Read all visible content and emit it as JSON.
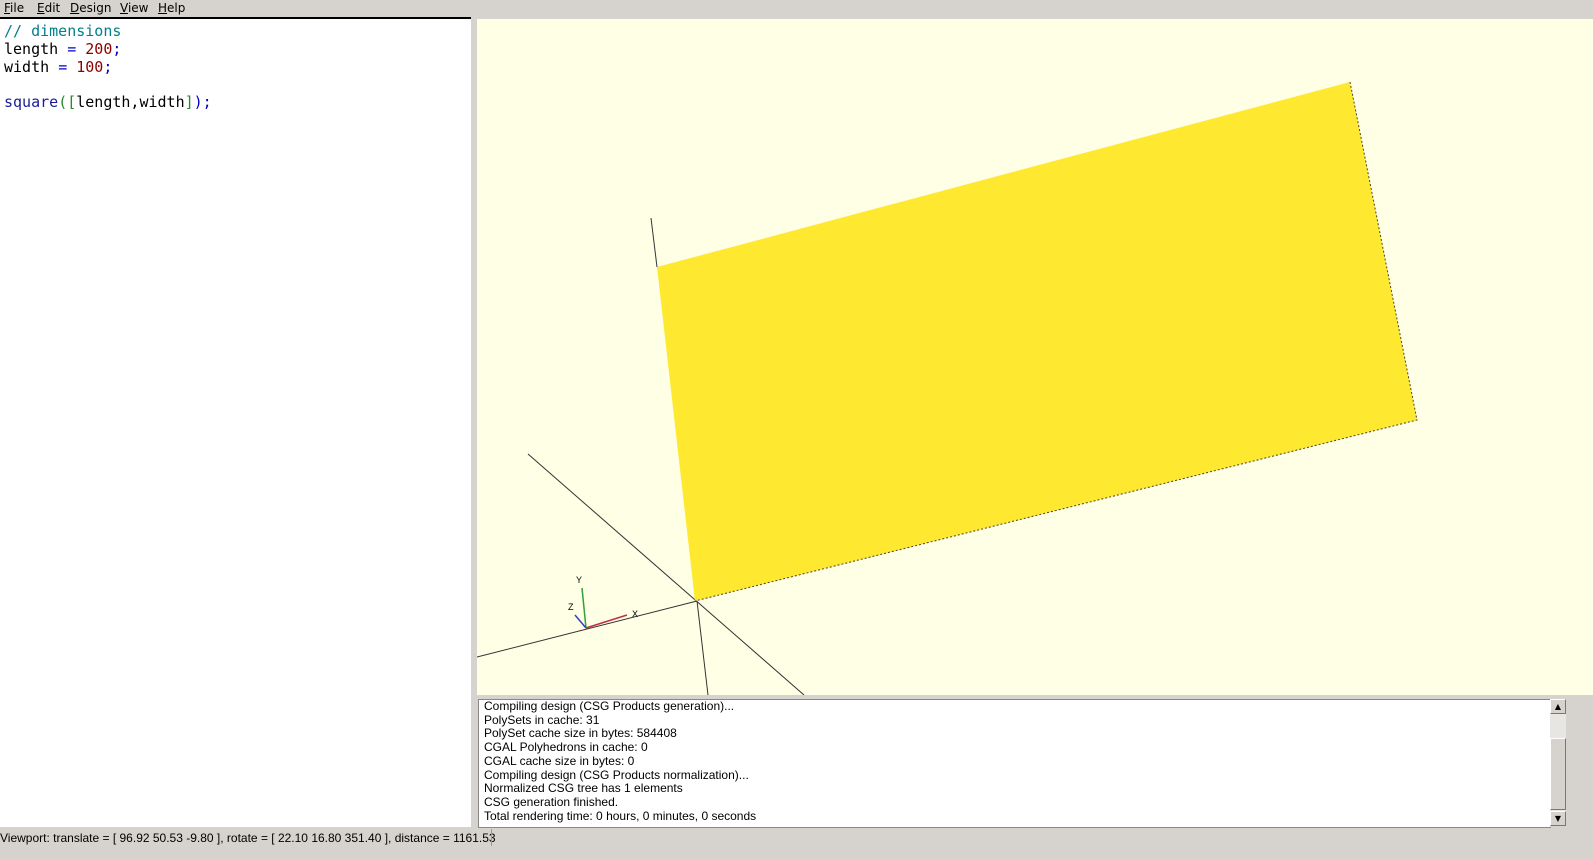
{
  "menu": {
    "file": {
      "accel": "F",
      "rest": "ile"
    },
    "edit": {
      "accel": "E",
      "rest": "dit"
    },
    "design": {
      "accel": "D",
      "rest": "esign"
    },
    "view": {
      "accel": "V",
      "rest": "iew"
    },
    "help": {
      "accel": "H",
      "rest": "elp"
    }
  },
  "editor": {
    "line1": {
      "comment": "// dimensions"
    },
    "line2": {
      "name": "length ",
      "op": "=",
      "num": " 200",
      "semi": ";"
    },
    "line3": {
      "name": "width ",
      "op": "=",
      "num": " 100",
      "semi": ";"
    },
    "line5": {
      "fn": "square",
      "open": "([",
      "args": "length,width",
      "close": "]",
      "end": ");"
    }
  },
  "viewport": {
    "axis_x_label": "X",
    "axis_y_label": "Y",
    "axis_z_label": "Z",
    "shape_color": "#ffe830",
    "background_color": "#ffffe5"
  },
  "console": {
    "lines": [
      "Compiling design (CSG Products generation)...",
      "PolySets in cache: 31",
      "PolySet cache size in bytes: 584408",
      "CGAL Polyhedrons in cache: 0",
      "CGAL cache size in bytes: 0",
      "Compiling design (CSG Products normalization)...",
      "Normalized CSG tree has 1 elements",
      "CSG generation finished.",
      "Total rendering time: 0 hours, 0 minutes, 0 seconds"
    ]
  },
  "scrollbar": {
    "up_arrow": "▲",
    "down_arrow": "▼"
  },
  "status": {
    "text": "Viewport: translate = [ 96.92 50.53 -9.80 ], rotate = [ 22.10 16.80 351.40 ], distance = 1161.53"
  }
}
